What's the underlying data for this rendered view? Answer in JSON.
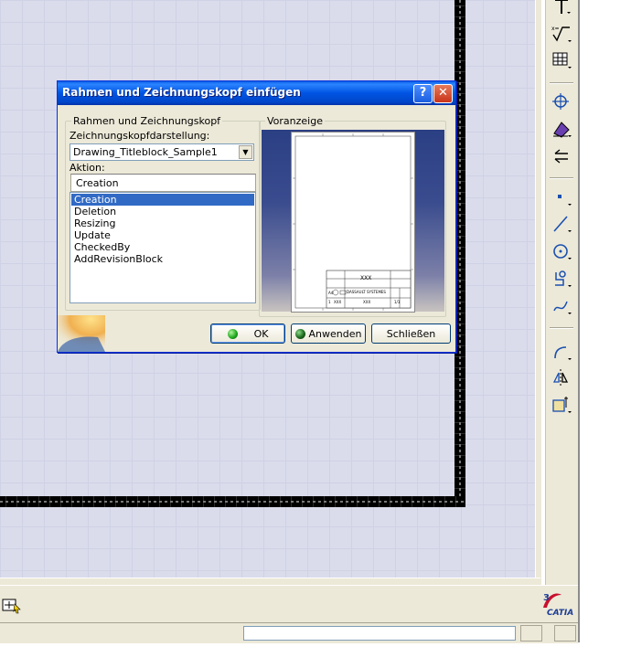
{
  "dialog": {
    "title": "Rahmen und Zeichnungskopf einfügen",
    "help_label": "?",
    "close_label": "✕",
    "group_label": "Rahmen und Zeichnungskopf",
    "style_label": "Zeichnungskopfdarstellung:",
    "style_value": "Drawing_Titleblock_Sample1",
    "action_label": "Aktion:",
    "action_value": "Creation",
    "actions": [
      "Creation",
      "Deletion",
      "Resizing",
      "Update",
      "CheckedBy",
      "AddRevisionBlock"
    ],
    "selected_action": "Creation",
    "preview_label": "Voranzeige",
    "preview_title_text": "XXX",
    "preview_company_text": "DASSAULT SYSTEMES",
    "preview_size_text": "A4",
    "preview_scale_text": "1",
    "preview_xxx2": "XXX",
    "preview_xxx3": "XXX",
    "preview_sheet_text": "1/1",
    "ok_label": "OK",
    "apply_label": "Anwenden",
    "close_button_label": "Schließen"
  },
  "toolbar": {
    "icons": [
      "text-icon",
      "roughness-symbol-icon",
      "table-icon",
      "center-point-icon",
      "area-fill-icon",
      "arrow-icon",
      "point-icon",
      "line-icon",
      "circle-icon",
      "profile-icon",
      "spline-icon",
      "corner-icon",
      "symmetry-icon",
      "2d-component-icon"
    ]
  },
  "logo": {
    "text": "CATIA"
  },
  "colors": {
    "titlebar": "#0054e3",
    "selection": "#316ac5",
    "canvas": "#dadcec",
    "panel": "#ece9d8"
  }
}
